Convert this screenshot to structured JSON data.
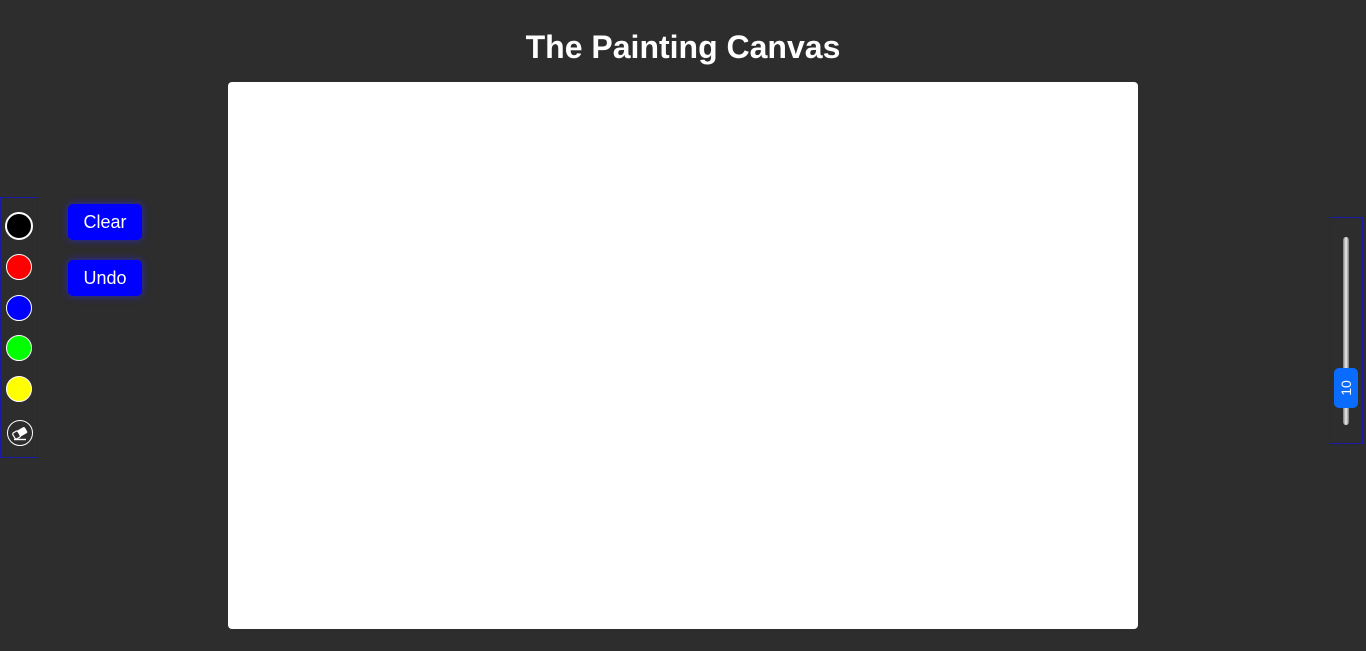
{
  "header": {
    "title": "The Painting Canvas"
  },
  "palette": {
    "selected": "black",
    "colors": [
      {
        "name": "black",
        "hex": "#000000"
      },
      {
        "name": "red",
        "hex": "#ff0000"
      },
      {
        "name": "blue",
        "hex": "#0000ff"
      },
      {
        "name": "green",
        "hex": "#00ff00"
      },
      {
        "name": "yellow",
        "hex": "#ffff00"
      }
    ],
    "eraser_icon": "eraser-icon"
  },
  "actions": {
    "clear_label": "Clear",
    "undo_label": "Undo",
    "button_color": "#0000ff"
  },
  "brush": {
    "size": 10
  },
  "colors": {
    "background": "#2d2d2d",
    "canvas": "#ffffff",
    "slider_thumb": "#0a6cff",
    "panel_border": "#1a1aa8"
  }
}
